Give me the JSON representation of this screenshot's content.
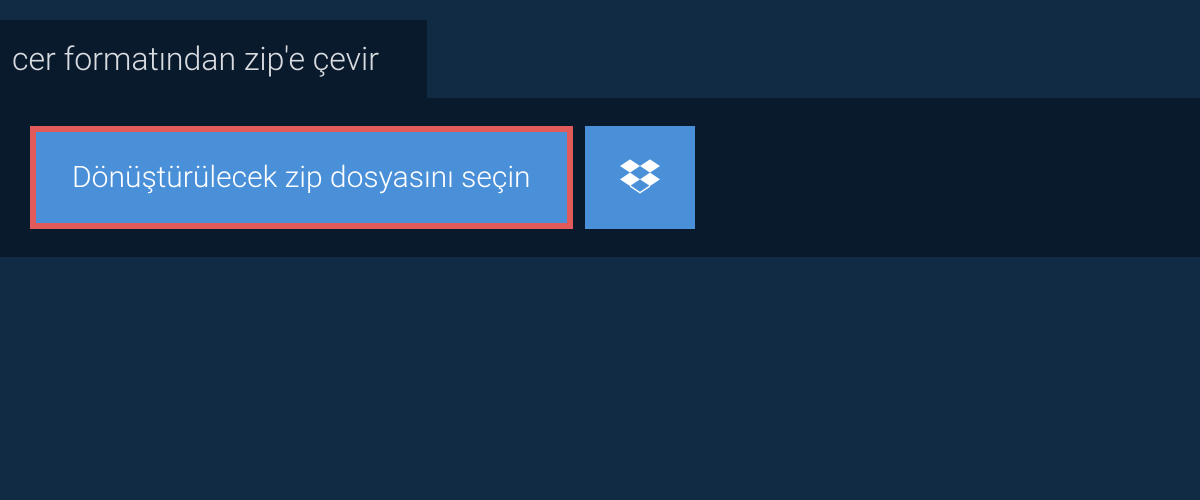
{
  "header": {
    "title": "cer formatından zip'e çevir"
  },
  "main": {
    "select_file_label": "Dönüştürülecek zip dosyasını seçin"
  },
  "colors": {
    "background": "#122b44",
    "panel": "#0a1a2d",
    "button": "#4a90d9",
    "highlight_border": "#e15b5b",
    "text_light": "#d8dce0",
    "text_white": "#ffffff"
  }
}
